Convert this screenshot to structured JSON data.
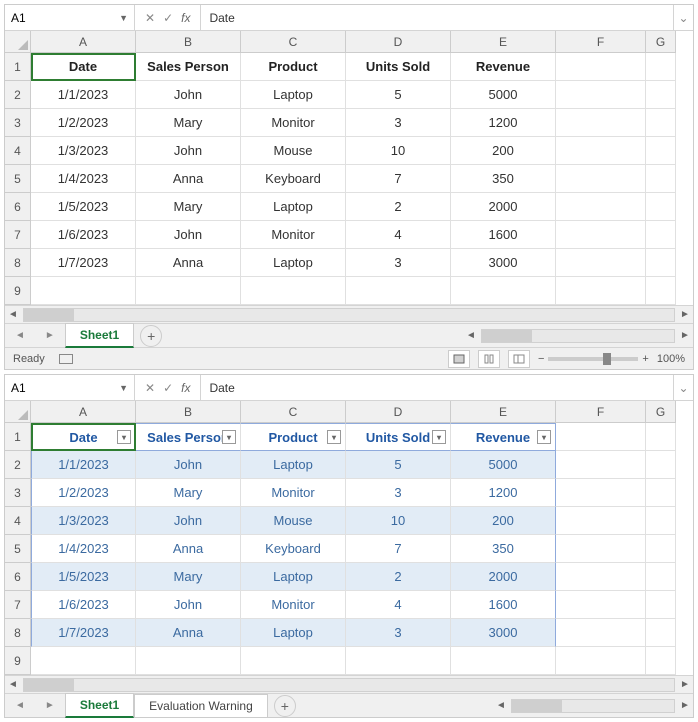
{
  "columns": [
    "A",
    "B",
    "C",
    "D",
    "E",
    "F",
    "G"
  ],
  "row_nums": [
    1,
    2,
    3,
    4,
    5,
    6,
    7,
    8,
    9
  ],
  "headers": [
    "Date",
    "Sales Person",
    "Product",
    "Units Sold",
    "Revenue"
  ],
  "rows": [
    [
      "1/1/2023",
      "John",
      "Laptop",
      "5",
      "5000"
    ],
    [
      "1/2/2023",
      "Mary",
      "Monitor",
      "3",
      "1200"
    ],
    [
      "1/3/2023",
      "John",
      "Mouse",
      "10",
      "200"
    ],
    [
      "1/4/2023",
      "Anna",
      "Keyboard",
      "7",
      "350"
    ],
    [
      "1/5/2023",
      "Mary",
      "Laptop",
      "2",
      "2000"
    ],
    [
      "1/6/2023",
      "John",
      "Monitor",
      "4",
      "1600"
    ],
    [
      "1/7/2023",
      "Anna",
      "Laptop",
      "3",
      "3000"
    ]
  ],
  "top": {
    "cell_ref": "A1",
    "formula_value": "Date",
    "tabs": [
      "Sheet1"
    ],
    "status": "Ready",
    "zoom": "100%"
  },
  "bottom": {
    "cell_ref": "A1",
    "formula_value": "Date",
    "tabs": [
      "Sheet1",
      "Evaluation Warning"
    ]
  }
}
